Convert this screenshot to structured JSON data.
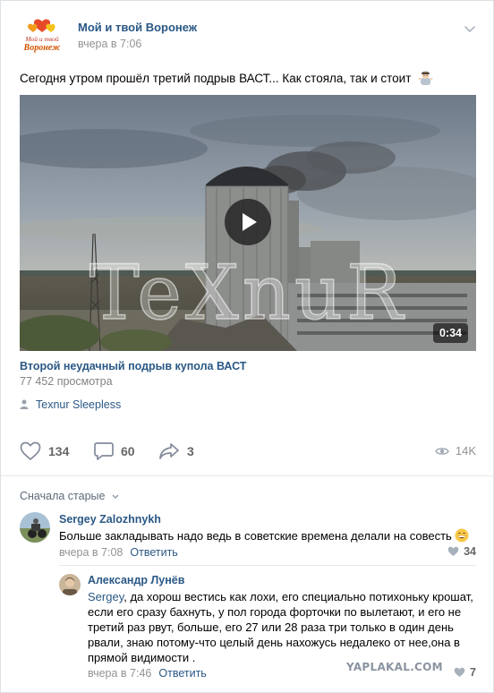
{
  "post": {
    "group_name": "Мой и твой Воронеж",
    "date": "вчера в 7:06",
    "logo_text_top": "Мой и твой",
    "logo_text_bottom": "Воронеж",
    "text": "Сегодня утром прошёл третий подрыв ВАСТ... Как стояла, так и стоит",
    "emoji": "man-shrugging-emoji"
  },
  "video": {
    "watermark": "TeXnuR",
    "duration": "0:34",
    "title": "Второй неудачный подрыв купола ВАСТ",
    "views": "77 452 просмотра",
    "author": "Texnur Sleepless"
  },
  "actions": {
    "likes": "134",
    "comments": "60",
    "shares": "3",
    "views": "14K"
  },
  "comments": {
    "sort_label": "Сначала старые",
    "items": [
      {
        "author": "Sergey Zalozhnykh",
        "text": "Больше закладывать надо ведь в советские времена делали на совесть",
        "time": "вчера в 7:08",
        "reply_label": "Ответить",
        "likes": "34"
      },
      {
        "author": "Александр Лунёв",
        "mention": "Sergey",
        "text": ", да хорош вестись как лохи, его специально потихоньку крошат, если его сразу бахнуть, у пол города форточки по вылетают, и его не третий раз рвут, больше, его 27 или 28 раза три только в один день рвали, знаю потому-что целый день нахожусь недалеко от нее,она в прямой видимости .",
        "time": "вчера в 7:46",
        "reply_label": "Ответить",
        "likes": "7"
      }
    ]
  },
  "site_watermark": "YAPLAKAL.COM",
  "colors": {
    "link": "#2a5885",
    "meta": "#939393",
    "border": "#e7e8ec"
  }
}
